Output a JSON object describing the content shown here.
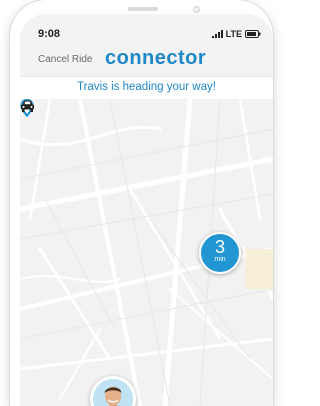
{
  "status_bar": {
    "time": "9:08",
    "network": "LTE"
  },
  "header": {
    "cancel_label": "Cancel Ride",
    "logo_text": "connector"
  },
  "banner": {
    "message": "Travis is heading your way!"
  },
  "eta": {
    "value": "3",
    "unit": "min"
  },
  "colors": {
    "brand_blue": "#1e88c8",
    "eta_blue": "#2196d3",
    "map_bg": "#f2f2f2",
    "road": "#ffffff"
  },
  "icons": {
    "destination": "location-pin-icon",
    "vehicle": "car-icon",
    "driver": "driver-avatar"
  }
}
